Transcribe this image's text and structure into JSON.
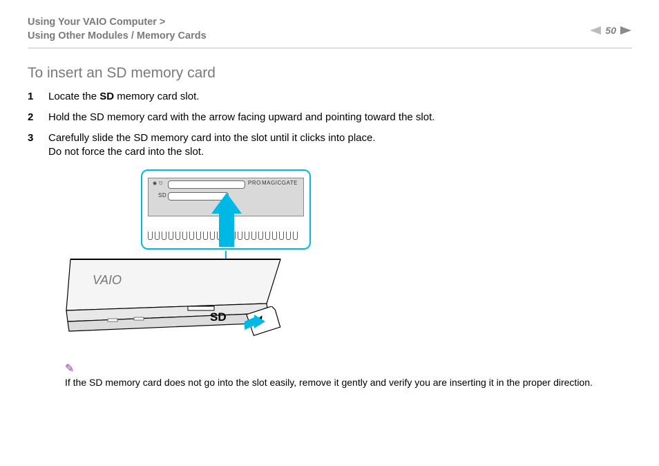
{
  "header": {
    "breadcrumb_line1": "Using Your VAIO Computer >",
    "breadcrumb_line2": "Using Other Modules / Memory Cards",
    "page_number": "50"
  },
  "content": {
    "section_title": "To insert an SD memory card",
    "steps": [
      {
        "num": "1",
        "pre": "Locate the ",
        "bold": "SD",
        "post": " memory card slot."
      },
      {
        "num": "2",
        "pre": "Hold the SD memory card with the arrow facing upward and pointing toward the slot.",
        "bold": "",
        "post": ""
      },
      {
        "num": "3",
        "pre": "Carefully slide the SD memory card into the slot until it clicks into place.\nDo not force the card into the slot.",
        "bold": "",
        "post": ""
      }
    ],
    "illustration": {
      "callout_labels": {
        "pro": "PRO",
        "magicgate": "MAGICGATE",
        "sd": "SD"
      },
      "sd_label": "SD",
      "laptop_logo": "VAIO"
    },
    "note": {
      "icon_name": "pencil-note-icon",
      "text": "If the SD memory card does not go into the slot easily, remove it gently and verify you are inserting it in the proper direction."
    }
  }
}
